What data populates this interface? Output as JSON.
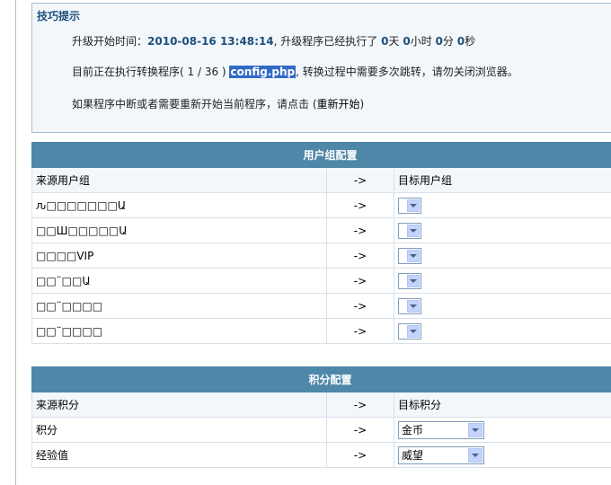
{
  "tips": {
    "title": "技巧提示",
    "line1_prefix": "升级开始时间：",
    "start_time": "2010-08-16 13:48:14",
    "line1_mid": ", 升级程序已经执行了",
    "days": "0",
    "days_unit": "天",
    "hours": "0",
    "hours_unit": "小时",
    "minutes": "0",
    "minutes_unit": "分",
    "seconds": "0",
    "seconds_unit": "秒",
    "line2_prefix": "目前正在执行转换程序(",
    "progress": "1 / 36",
    "line2_paren_close": ")",
    "current_file": "config.php",
    "line2_suffix": ", 转换过程中需要多次跳转，请勿关闭浏览器。",
    "line3_prefix": "如果程序中断或者需要重新开始当前程序，请点击 (",
    "restart_label": "重新开始",
    "line3_suffix": ")"
  },
  "usergroup": {
    "header": "用户组配置",
    "col_source": "来源用户组",
    "col_arrow": "->",
    "col_target": "目标用户组",
    "rows": [
      {
        "source": "ԉ□□□□□□□Ա",
        "arrow": "->"
      },
      {
        "source": "□□Ш□□□□□Ա",
        "arrow": "->"
      },
      {
        "source": "□□□□VIP",
        "arrow": "->"
      },
      {
        "source": "□□¨□□Ա",
        "arrow": "->"
      },
      {
        "source": "□□¨□□□□",
        "arrow": "->"
      },
      {
        "source": "□□¨□□□□",
        "arrow": "->"
      }
    ]
  },
  "credits": {
    "header": "积分配置",
    "col_source": "来源积分",
    "col_arrow": "->",
    "col_target": "目标积分",
    "rows": [
      {
        "source": "积分",
        "arrow": "->",
        "selected": "金币"
      },
      {
        "source": "经验值",
        "arrow": "->",
        "selected": "威望"
      }
    ]
  }
}
